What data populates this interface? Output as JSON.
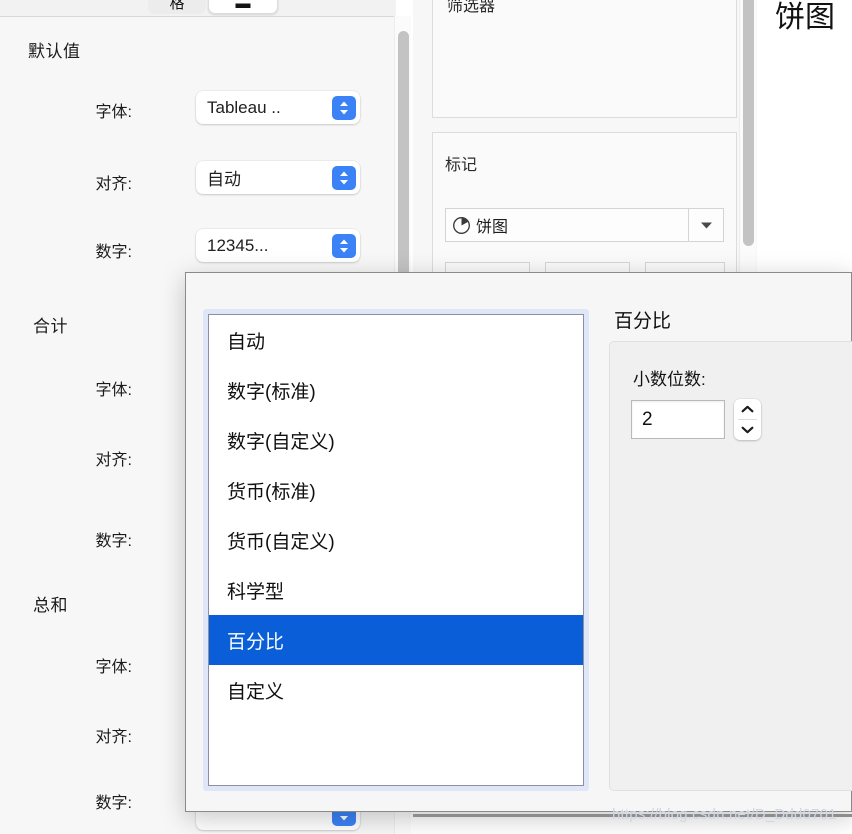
{
  "format_pane": {
    "tabs": [
      {
        "label": "格",
        "active": false
      },
      {
        "label": "▬",
        "active": true
      }
    ],
    "sections": [
      {
        "title": "默认值",
        "fields": [
          {
            "label": "字体:",
            "value": "Tableau .."
          },
          {
            "label": "对齐:",
            "value": "自动"
          },
          {
            "label": "数字:",
            "value": "12345..."
          }
        ]
      },
      {
        "title": "合计",
        "fields": [
          {
            "label": "字体:",
            "value": ""
          },
          {
            "label": "对齐:",
            "value": ""
          },
          {
            "label": "数字:",
            "value": ""
          }
        ]
      },
      {
        "title": "总和",
        "fields": [
          {
            "label": "字体:",
            "value": ""
          },
          {
            "label": "对齐:",
            "value": ""
          },
          {
            "label": "数字:",
            "value": ""
          }
        ]
      }
    ]
  },
  "worksheet": {
    "filters_card_title": "筛选器",
    "marks_card_title": "标记",
    "marks_type": "饼图",
    "marks_icon": "pie-chart-icon",
    "dropdown_icon": "chevron-down-icon",
    "right_label": "饼图"
  },
  "dialog": {
    "list": {
      "items": [
        "自动",
        "数字(标准)",
        "数字(自定义)",
        "货币(标准)",
        "货币(自定义)",
        "科学型",
        "百分比",
        "自定义"
      ],
      "selected_index": 6
    },
    "detail": {
      "title": "百分比",
      "field_label": "小数位数:",
      "field_value": "2",
      "stepper_up_icon": "chevron-up-icon",
      "stepper_down_icon": "chevron-down-icon"
    }
  },
  "watermark": {
    "text": "https://blog.csdn.net/D_Ddd0701"
  },
  "colors": {
    "selection_blue": "#0a5ed7",
    "stepper_blue": "#3b82f6",
    "dialog_border": "#8a8a8a",
    "listbox_focus_ring": "#dfe6f7"
  }
}
